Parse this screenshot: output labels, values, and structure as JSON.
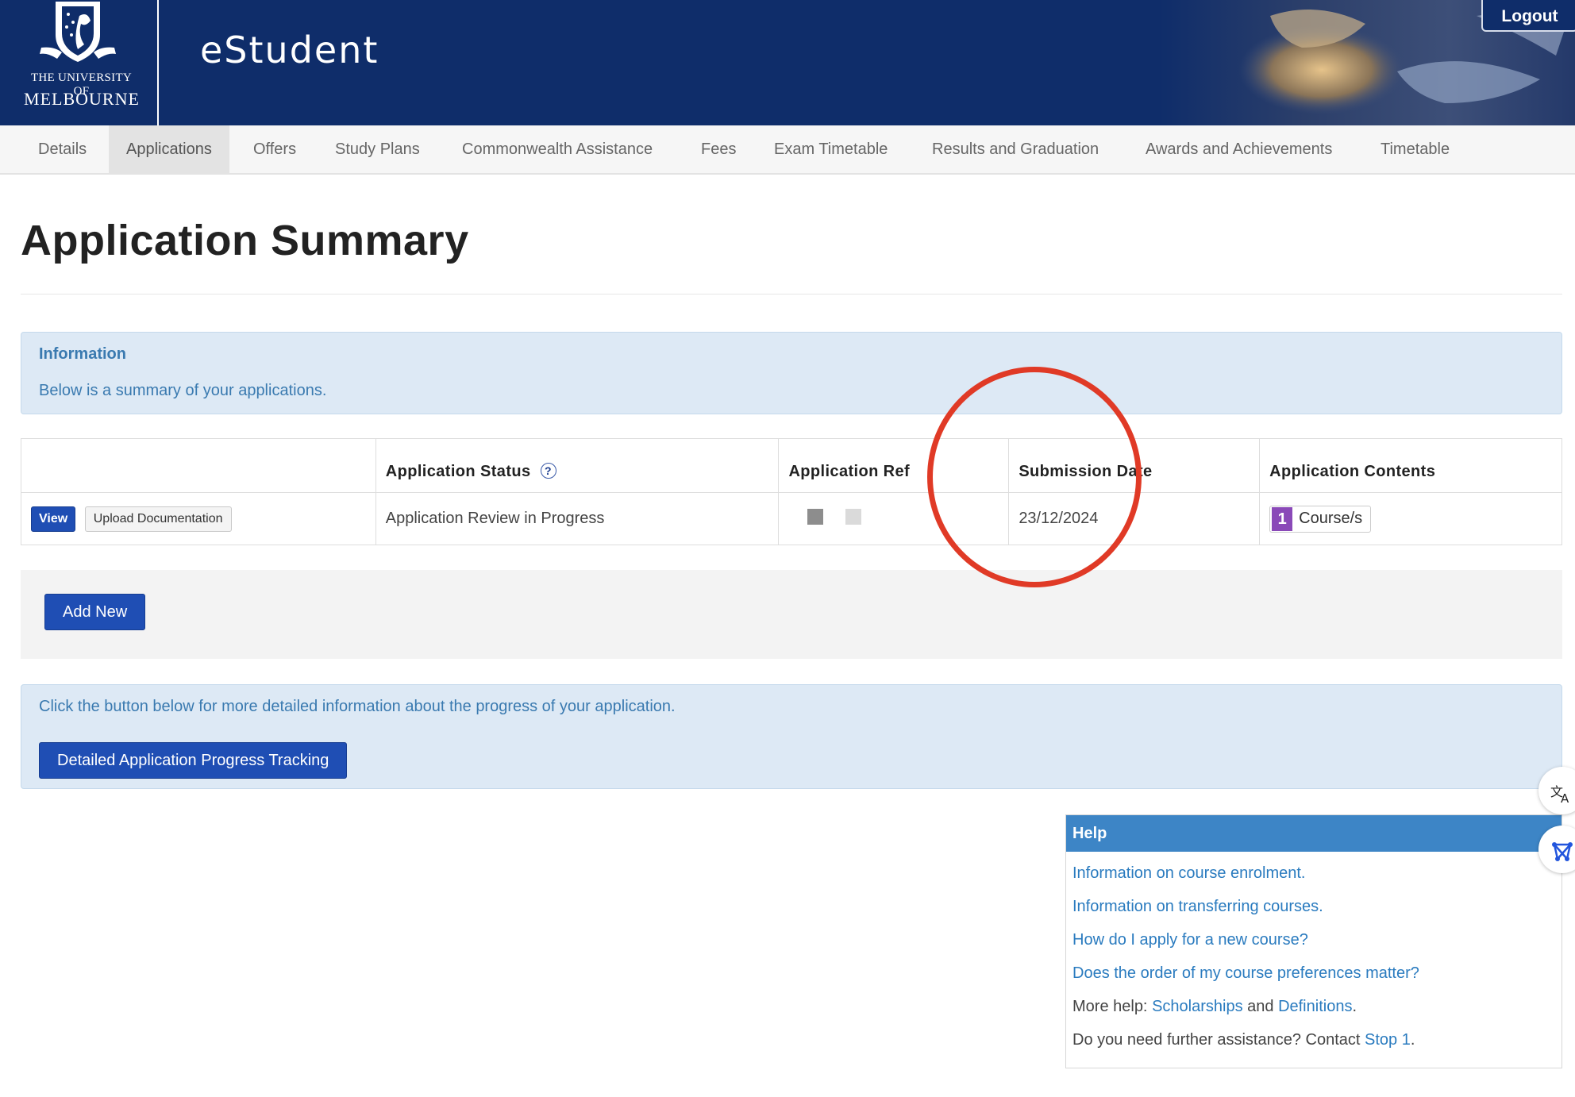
{
  "header": {
    "university_line1": "THE UNIVERSITY OF",
    "university_line2": "MELBOURNE",
    "app_title": "eStudent",
    "logout_label": "Logout"
  },
  "nav": {
    "items": [
      {
        "label": "Details"
      },
      {
        "label": "Applications",
        "active": true
      },
      {
        "label": "Offers"
      },
      {
        "label": "Study Plans"
      },
      {
        "label": "Commonwealth Assistance"
      },
      {
        "label": "Fees"
      },
      {
        "label": "Exam Timetable"
      },
      {
        "label": "Results and Graduation"
      },
      {
        "label": "Awards and Achievements"
      },
      {
        "label": "Timetable"
      }
    ]
  },
  "page": {
    "title": "Application Summary"
  },
  "info": {
    "title": "Information",
    "text": "Below is a summary of your applications."
  },
  "table": {
    "headers": {
      "status": "Application Status",
      "status_help": "?",
      "ref": "Application Ref",
      "date": "Submission Date",
      "contents": "Application Contents"
    },
    "rows": [
      {
        "view_label": "View",
        "upload_label": "Upload Documentation",
        "status": "Application Review in Progress",
        "date": "23/12/2024",
        "contents_count": "1",
        "contents_label": "Course/s"
      }
    ]
  },
  "actions": {
    "add_new_label": "Add New"
  },
  "progress": {
    "text": "Click the button below for more detailed information about the progress of your application.",
    "button_label": "Detailed Application Progress Tracking"
  },
  "help": {
    "title": "Help",
    "links": [
      "Information on course enrolment.",
      "Information on transferring courses.",
      "How do I apply for a new course?",
      "Does the order of my course preferences matter?"
    ],
    "more_help_prefix": "More help: ",
    "scholarships": "Scholarships",
    "and": " and ",
    "definitions": "Definitions",
    "period": ".",
    "contact_prefix": "Do you need further assistance? Contact ",
    "contact_link": "Stop 1",
    "contact_suffix": "."
  },
  "colors": {
    "header_bg": "#0f2d6a",
    "primary_button": "#1f4eb4",
    "info_bg": "#dde9f5",
    "info_text": "#3a7ab0",
    "help_header": "#3d85c6",
    "annotation": "#e03a26",
    "badge": "#8a49b8"
  },
  "icons": {
    "translate": "translate-icon",
    "network": "network-icon",
    "help": "question-icon"
  }
}
